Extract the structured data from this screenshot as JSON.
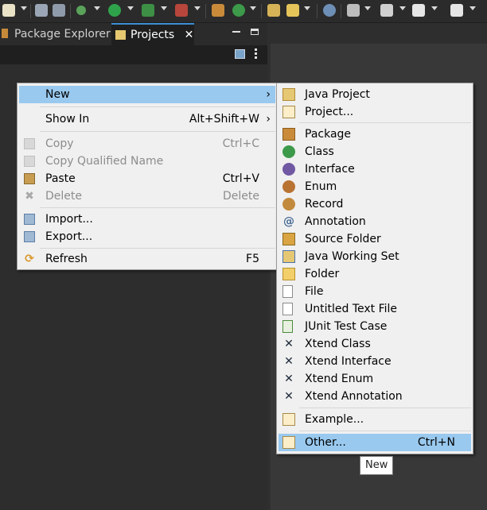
{
  "toolbar": {
    "icons": [
      "new-wizard-icon",
      "save-icon",
      "save-all-icon",
      "debug-icon",
      "run-icon",
      "run-coverage-icon",
      "external-tools-icon",
      "new-java-package-icon",
      "new-java-class-icon",
      "open-type-icon",
      "highlight-icon",
      "toggle-breadcrumb-icon",
      "annotation-icon",
      "last-edit-icon",
      "back-icon",
      "forward-icon"
    ]
  },
  "tabs": {
    "package_explorer": "Package Explorer",
    "projects": "Projects",
    "close": "✕"
  },
  "context_menu": {
    "items": [
      {
        "label": "New",
        "accel": "",
        "submenu": true,
        "enabled": true,
        "highlighted": true,
        "icon": "none"
      },
      {
        "label": "Show In",
        "accel": "Alt+Shift+W",
        "submenu": true,
        "enabled": true,
        "icon": "none"
      },
      {
        "label": "Copy",
        "accel": "Ctrl+C",
        "enabled": false,
        "icon": "copy-icon"
      },
      {
        "label": "Copy Qualified Name",
        "accel": "",
        "enabled": false,
        "icon": "copy-qualified-icon"
      },
      {
        "label": "Paste",
        "accel": "Ctrl+V",
        "enabled": true,
        "icon": "paste-icon"
      },
      {
        "label": "Delete",
        "accel": "Delete",
        "enabled": false,
        "icon": "delete-icon"
      },
      {
        "label": "Import...",
        "accel": "",
        "enabled": true,
        "icon": "import-icon"
      },
      {
        "label": "Export...",
        "accel": "",
        "enabled": true,
        "icon": "export-icon"
      },
      {
        "label": "Refresh",
        "accel": "F5",
        "enabled": true,
        "icon": "refresh-icon"
      }
    ]
  },
  "new_submenu": {
    "items": [
      {
        "label": "Java Project",
        "accel": "",
        "icon": "java-project-icon"
      },
      {
        "label": "Project...",
        "accel": "",
        "icon": "project-icon"
      },
      {
        "label": "Package",
        "accel": "",
        "icon": "package-icon"
      },
      {
        "label": "Class",
        "accel": "",
        "icon": "class-icon"
      },
      {
        "label": "Interface",
        "accel": "",
        "icon": "interface-icon"
      },
      {
        "label": "Enum",
        "accel": "",
        "icon": "enum-icon"
      },
      {
        "label": "Record",
        "accel": "",
        "icon": "record-icon"
      },
      {
        "label": "Annotation",
        "accel": "",
        "icon": "annotation-icon"
      },
      {
        "label": "Source Folder",
        "accel": "",
        "icon": "source-folder-icon"
      },
      {
        "label": "Java Working Set",
        "accel": "",
        "icon": "working-set-icon"
      },
      {
        "label": "Folder",
        "accel": "",
        "icon": "folder-icon"
      },
      {
        "label": "File",
        "accel": "",
        "icon": "file-icon"
      },
      {
        "label": "Untitled Text File",
        "accel": "",
        "icon": "text-file-icon"
      },
      {
        "label": "JUnit Test Case",
        "accel": "",
        "icon": "junit-icon"
      },
      {
        "label": "Xtend Class",
        "accel": "",
        "icon": "xtend-icon"
      },
      {
        "label": "Xtend Interface",
        "accel": "",
        "icon": "xtend-icon"
      },
      {
        "label": "Xtend Enum",
        "accel": "",
        "icon": "xtend-icon"
      },
      {
        "label": "Xtend Annotation",
        "accel": "",
        "icon": "xtend-icon"
      },
      {
        "label": "Example...",
        "accel": "",
        "icon": "example-icon"
      },
      {
        "label": "Other...",
        "accel": "Ctrl+N",
        "icon": "other-icon",
        "highlighted": true
      }
    ]
  },
  "tooltip": "New",
  "colors": {
    "highlight": "#99c9ef",
    "menu_bg": "#f0f0f0",
    "dark_bg": "#2d2d2d"
  }
}
